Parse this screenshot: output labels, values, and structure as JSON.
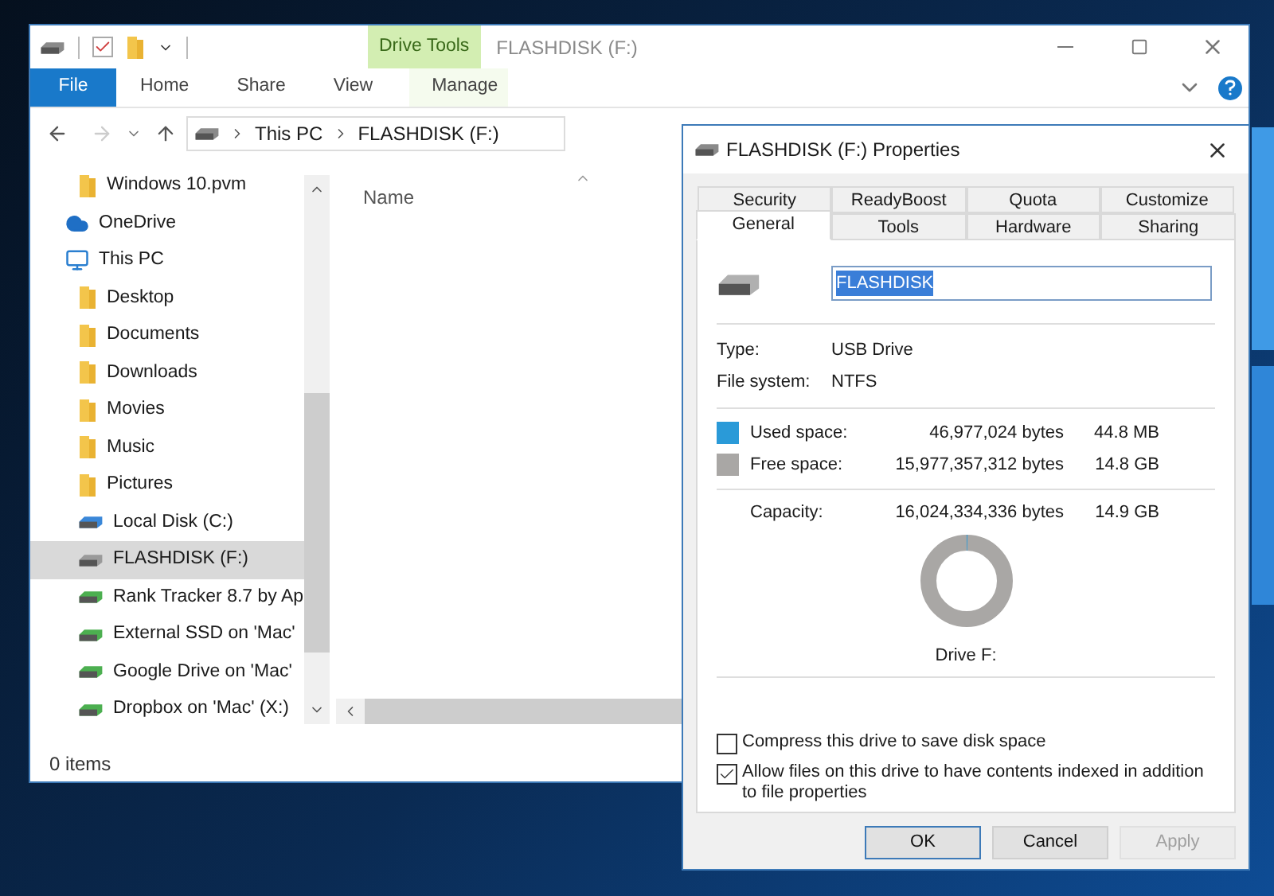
{
  "explorer": {
    "contextual_group": "Drive Tools",
    "title": "FLASHDISK (F:)",
    "ribbon_tabs": [
      {
        "label": "File",
        "kind": "file",
        "selected": false
      },
      {
        "label": "Home",
        "kind": "tab",
        "selected": false
      },
      {
        "label": "Share",
        "kind": "tab",
        "selected": false
      },
      {
        "label": "View",
        "kind": "tab",
        "selected": false
      },
      {
        "label": "Manage",
        "kind": "contextual",
        "selected": false
      }
    ],
    "address": [
      "This PC",
      "FLASHDISK (F:)"
    ],
    "nav_items": [
      {
        "label": "Windows 10.pvm",
        "kind": "folder",
        "selected": false
      },
      {
        "label": "OneDrive",
        "kind": "cloud",
        "selected": false
      },
      {
        "label": "This PC",
        "kind": "pc",
        "selected": false,
        "children": [
          {
            "label": "Desktop",
            "kind": "folder",
            "selected": false
          },
          {
            "label": "Documents",
            "kind": "folder",
            "selected": false
          },
          {
            "label": "Downloads",
            "kind": "folder",
            "selected": false
          },
          {
            "label": "Movies",
            "kind": "folder",
            "selected": false
          },
          {
            "label": "Music",
            "kind": "folder",
            "selected": false
          },
          {
            "label": "Pictures",
            "kind": "folder",
            "selected": false
          },
          {
            "label": "Local Disk (C:)",
            "kind": "system-drive",
            "selected": false
          },
          {
            "label": "FLASHDISK (F:)",
            "kind": "usb-drive",
            "selected": true
          },
          {
            "label": "Rank Tracker 8.7 by Ap",
            "kind": "network-drive",
            "selected": false
          },
          {
            "label": "External SSD on 'Mac'",
            "kind": "network-drive",
            "selected": false
          },
          {
            "label": "Google Drive on 'Mac'",
            "kind": "network-drive",
            "selected": false
          },
          {
            "label": "Dropbox on 'Mac' (X:)",
            "kind": "network-drive",
            "selected": false
          }
        ]
      }
    ],
    "column_header": "Name",
    "status": "0 items"
  },
  "dialog": {
    "title": "FLASHDISK (F:) Properties",
    "tab_rows": [
      [
        {
          "label": "Security",
          "selected": false
        },
        {
          "label": "ReadyBoost",
          "selected": false
        },
        {
          "label": "Quota",
          "selected": false
        },
        {
          "label": "Customize",
          "selected": false
        }
      ],
      [
        {
          "label": "General",
          "selected": true
        },
        {
          "label": "Tools",
          "selected": false
        },
        {
          "label": "Hardware",
          "selected": false
        },
        {
          "label": "Sharing",
          "selected": false
        }
      ]
    ],
    "name_field": {
      "value": "FLASHDISK",
      "selected": true
    },
    "properties": [
      {
        "label": "Type:",
        "value": "USB Drive"
      },
      {
        "label": "File system:",
        "value": "NTFS"
      }
    ],
    "space": [
      {
        "label": "Used space:",
        "bytes": "46,977,024 bytes",
        "size": "44.8 MB",
        "color": "#2a9ad8"
      },
      {
        "label": "Free space:",
        "bytes": "15,977,357,312 bytes",
        "size": "14.8 GB",
        "color": "#a9a7a5"
      }
    ],
    "capacity": {
      "label": "Capacity:",
      "bytes": "16,024,334,336 bytes",
      "size": "14.9 GB"
    },
    "usage": {
      "level": 0.003
    },
    "drive_label": "Drive F:",
    "options": [
      {
        "label": "Compress this drive to save disk space",
        "checked": false
      },
      {
        "label": "Allow files on this drive to have contents indexed in addition to file properties",
        "checked": true
      }
    ],
    "buttons": [
      {
        "label": "OK",
        "kind": "default",
        "disabled": false
      },
      {
        "label": "Cancel",
        "kind": "normal",
        "disabled": false
      },
      {
        "label": "Apply",
        "kind": "normal",
        "disabled": true
      }
    ]
  }
}
